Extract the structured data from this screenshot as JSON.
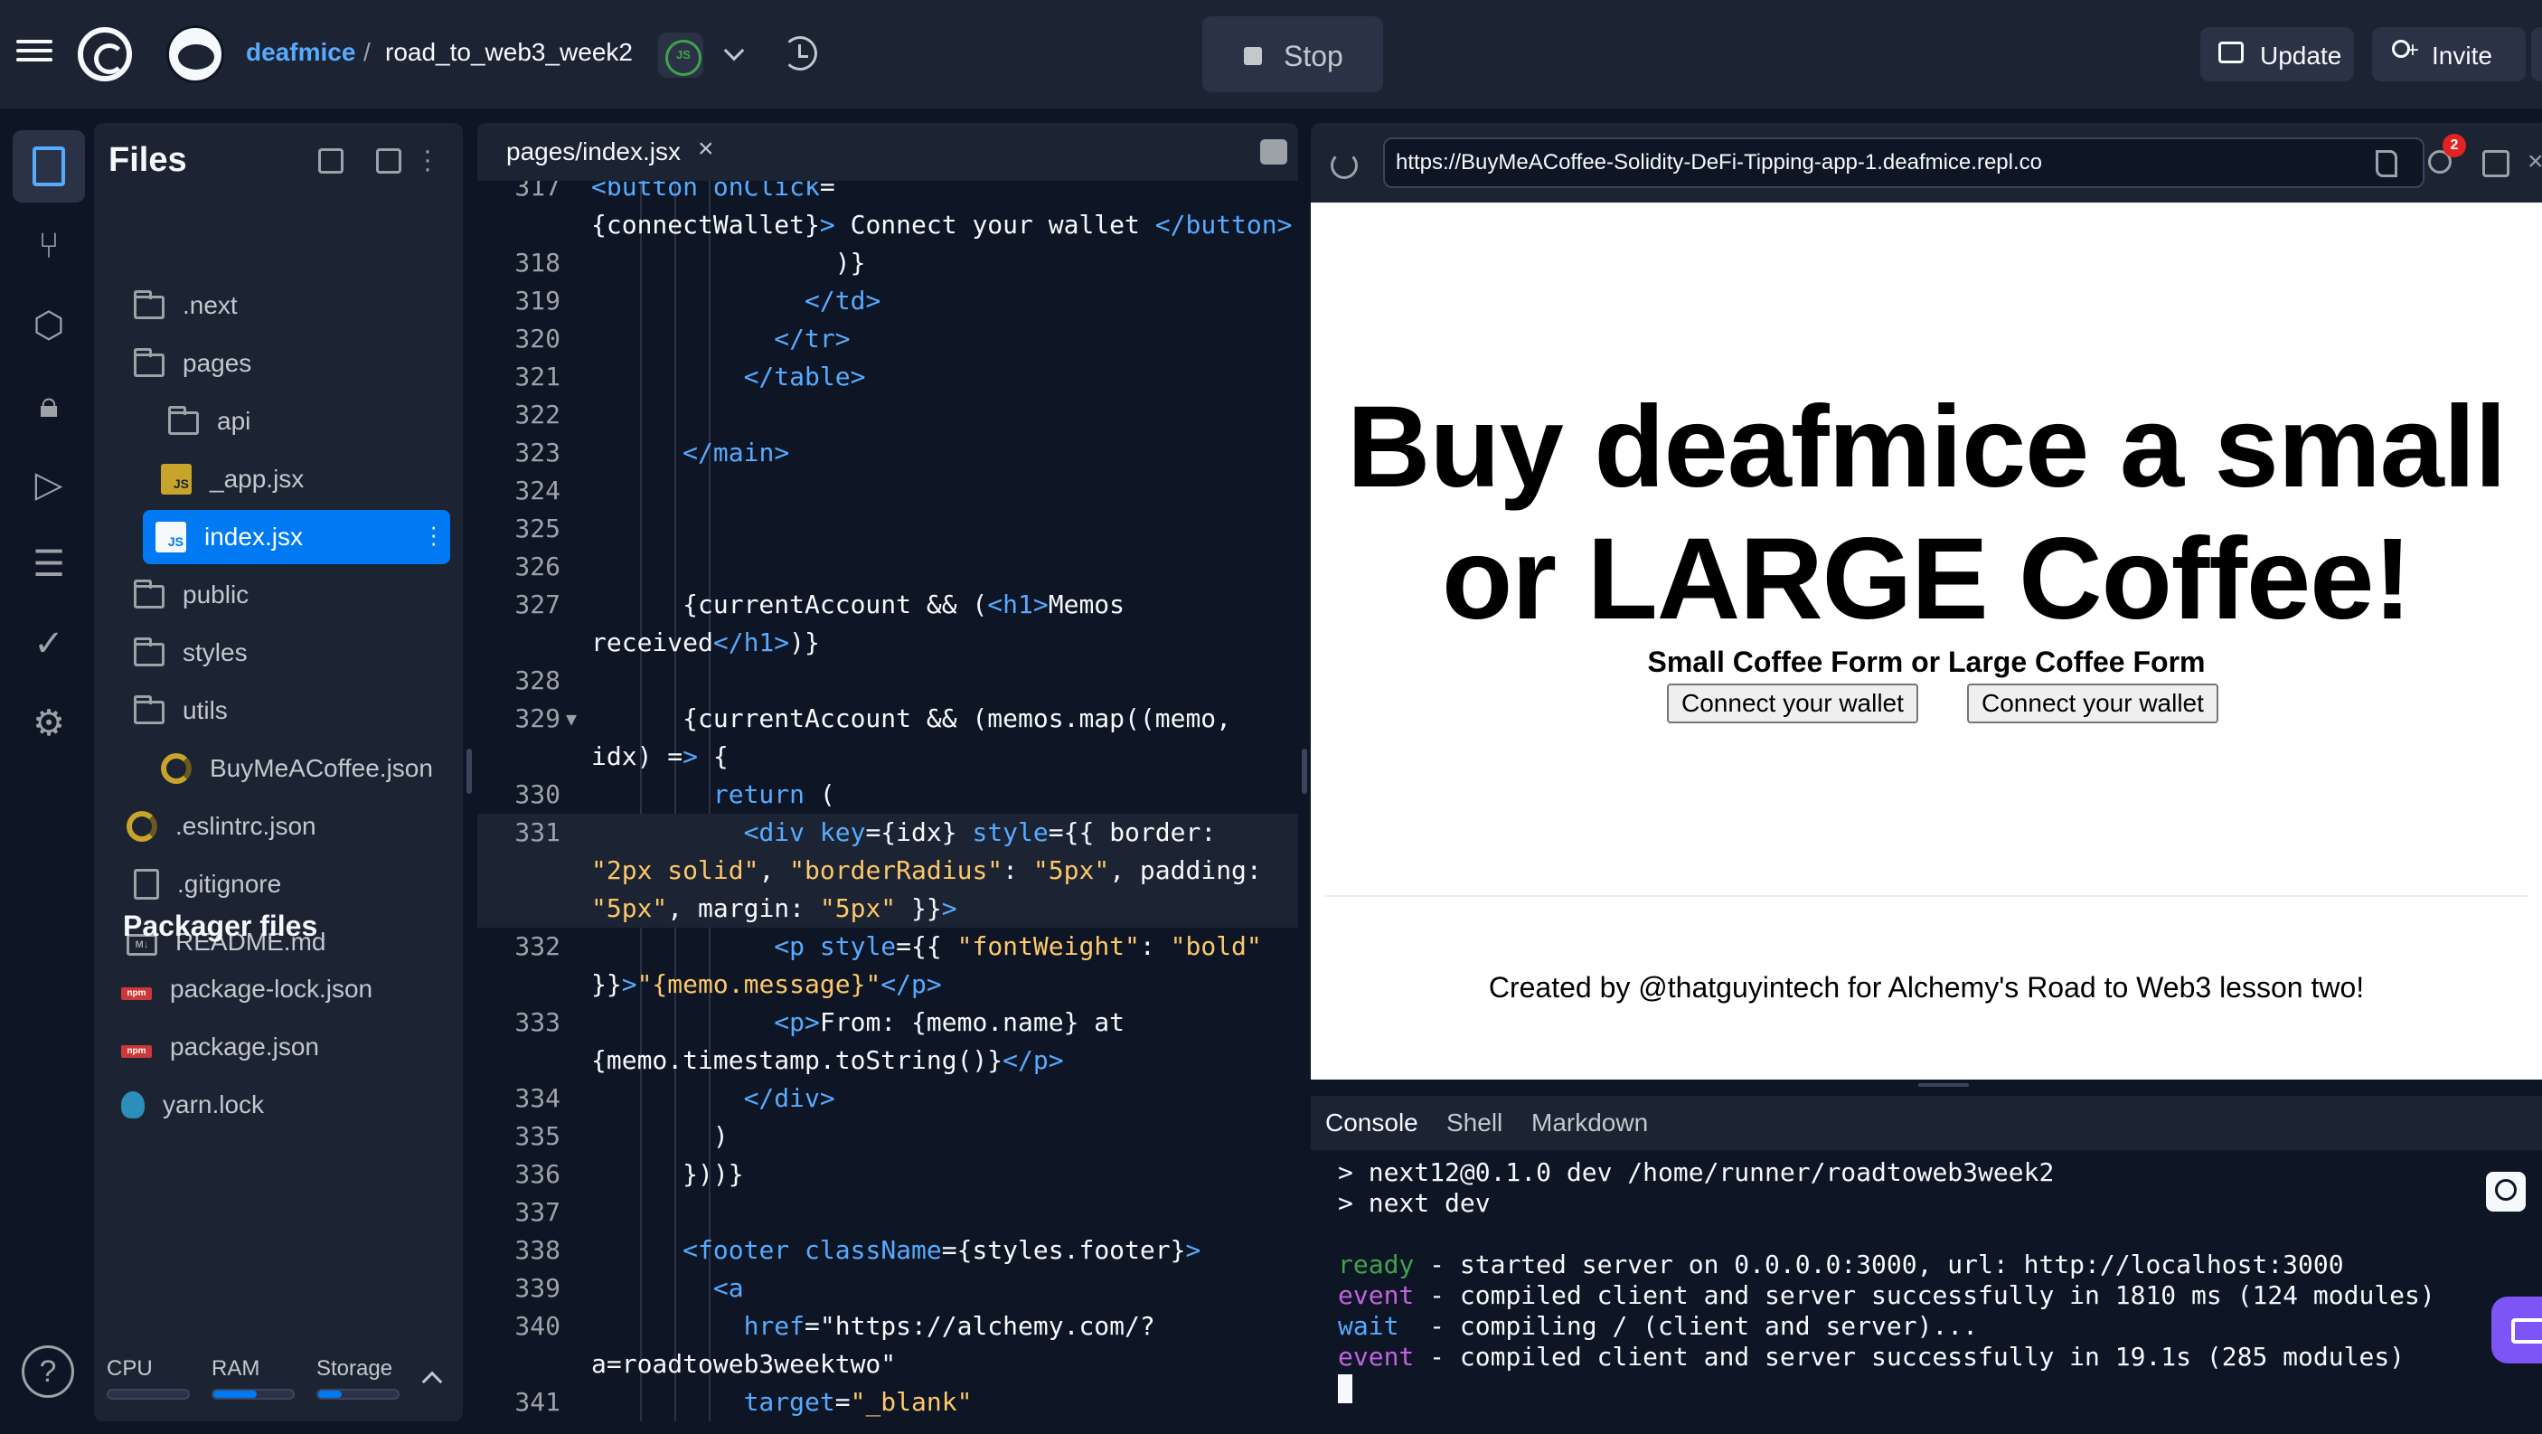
{
  "topbar": {
    "username": "deafmice",
    "separator": "/",
    "repl_name": "road_to_web3_week2",
    "language_badge": "JS",
    "stop_label": "Stop",
    "update_label": "Update",
    "invite_label": "Invite"
  },
  "files": {
    "title": "Files",
    "items": [
      {
        "label": ".next",
        "icon": "folder-icon"
      },
      {
        "label": "pages",
        "icon": "folder-icon"
      },
      {
        "label": "api",
        "icon": "folder-icon"
      },
      {
        "label": "_app.jsx",
        "icon": "js-file-icon"
      },
      {
        "label": "index.jsx",
        "icon": "js-file-icon",
        "selected": true
      },
      {
        "label": "public",
        "icon": "folder-icon"
      },
      {
        "label": "styles",
        "icon": "folder-icon"
      },
      {
        "label": "utils",
        "icon": "folder-icon"
      },
      {
        "label": "BuyMeACoffee.json",
        "icon": "json-file-icon"
      },
      {
        "label": ".eslintrc.json",
        "icon": "json-file-icon"
      },
      {
        "label": ".gitignore",
        "icon": "file-icon"
      },
      {
        "label": "README.md",
        "icon": "markdown-file-icon"
      }
    ],
    "packager_title": "Packager files",
    "packager_items": [
      {
        "label": "package-lock.json",
        "icon": "npm-icon"
      },
      {
        "label": "package.json",
        "icon": "npm-icon"
      },
      {
        "label": "yarn.lock",
        "icon": "yarn-icon"
      }
    ],
    "resources": {
      "cpu_label": "CPU",
      "cpu_usage": 0.0,
      "ram_label": "RAM",
      "ram_usage": 0.55,
      "storage_label": "Storage",
      "storage_usage": 0.3
    },
    "mdicon_text": "M↓",
    "npm_text": "npm"
  },
  "editor": {
    "tab_label": "pages/index.jsx",
    "tab_close": "×",
    "lines": [
      {
        "n": "317",
        "text": "<button onClick="
      },
      {
        "n": "",
        "text": "{connectWallet}> Connect your wallet </button>"
      },
      {
        "n": "318",
        "text": "                )}"
      },
      {
        "n": "319",
        "text": "              </td>"
      },
      {
        "n": "320",
        "text": "            </tr>"
      },
      {
        "n": "321",
        "text": "          </table>"
      },
      {
        "n": "322",
        "text": ""
      },
      {
        "n": "323",
        "text": "      </main>"
      },
      {
        "n": "324",
        "text": ""
      },
      {
        "n": "325",
        "text": ""
      },
      {
        "n": "326",
        "text": ""
      },
      {
        "n": "327",
        "text": "      {currentAccount && (<h1>Memos"
      },
      {
        "n": "",
        "text": "received</h1>)}"
      },
      {
        "n": "328",
        "text": ""
      },
      {
        "n": "329",
        "text": "      {currentAccount && (memos.map((memo,",
        "fold": "▼"
      },
      {
        "n": "",
        "text": "idx) => {"
      },
      {
        "n": "330",
        "text": "        return ("
      },
      {
        "n": "331",
        "text": "          <div key={idx} style={{ border:",
        "highlight": true
      },
      {
        "n": "",
        "text": "\"2px solid\", \"borderRadius\": \"5px\", padding:",
        "highlight": true
      },
      {
        "n": "",
        "text": "\"5px\", margin: \"5px\" }}>",
        "highlight": true
      },
      {
        "n": "332",
        "text": "            <p style={{ \"fontWeight\": \"bold\""
      },
      {
        "n": "",
        "text": "}}>\"{memo.message}\"</p>"
      },
      {
        "n": "333",
        "text": "            <p>From: {memo.name} at"
      },
      {
        "n": "",
        "text": "{memo.timestamp.toString()}</p>"
      },
      {
        "n": "334",
        "text": "          </div>"
      },
      {
        "n": "335",
        "text": "        )"
      },
      {
        "n": "336",
        "text": "      }))}"
      },
      {
        "n": "337",
        "text": ""
      },
      {
        "n": "338",
        "text": "      <footer className={styles.footer}>"
      },
      {
        "n": "339",
        "text": "        <a"
      },
      {
        "n": "340",
        "text": "          href=\"https://alchemy.com/?"
      },
      {
        "n": "",
        "text": "a=roadtoweb3weektwo\""
      },
      {
        "n": "341",
        "text": "          target=\"_blank\""
      }
    ]
  },
  "webview": {
    "url": "https://BuyMeACoffee-Solidity-DeFi-Tipping-app-1.deafmice.repl.co",
    "badge_count": "2",
    "page": {
      "heading_line1": "Buy deafmice a small",
      "heading_line2": "or LARGE Coffee!",
      "subheading": "Small Coffee Form or Large Coffee Form",
      "button1": "Connect your wallet",
      "button2": "Connect your wallet",
      "footer": "Created by @thatguyintech for Alchemy's Road to Web3 lesson two!"
    }
  },
  "console": {
    "tabs": [
      "Console",
      "Shell",
      "Markdown"
    ],
    "lines": [
      {
        "prefix": "",
        "text": "> next12@0.1.0 dev /home/runner/roadtoweb3week2"
      },
      {
        "prefix": "",
        "text": "> next dev"
      },
      {
        "prefix": "",
        "text": ""
      },
      {
        "prefix": "ready",
        "text": " - started server on 0.0.0.0:3000, url: http://localhost:3000"
      },
      {
        "prefix": "event",
        "text": " - compiled client and server successfully in 1810 ms (124 modules)"
      },
      {
        "prefix": "wait",
        "text": "  - compiling / (client and server)..."
      },
      {
        "prefix": "event",
        "text": " - compiled client and server successfully in 19.1s (285 modules)"
      }
    ]
  },
  "help_label": "?"
}
